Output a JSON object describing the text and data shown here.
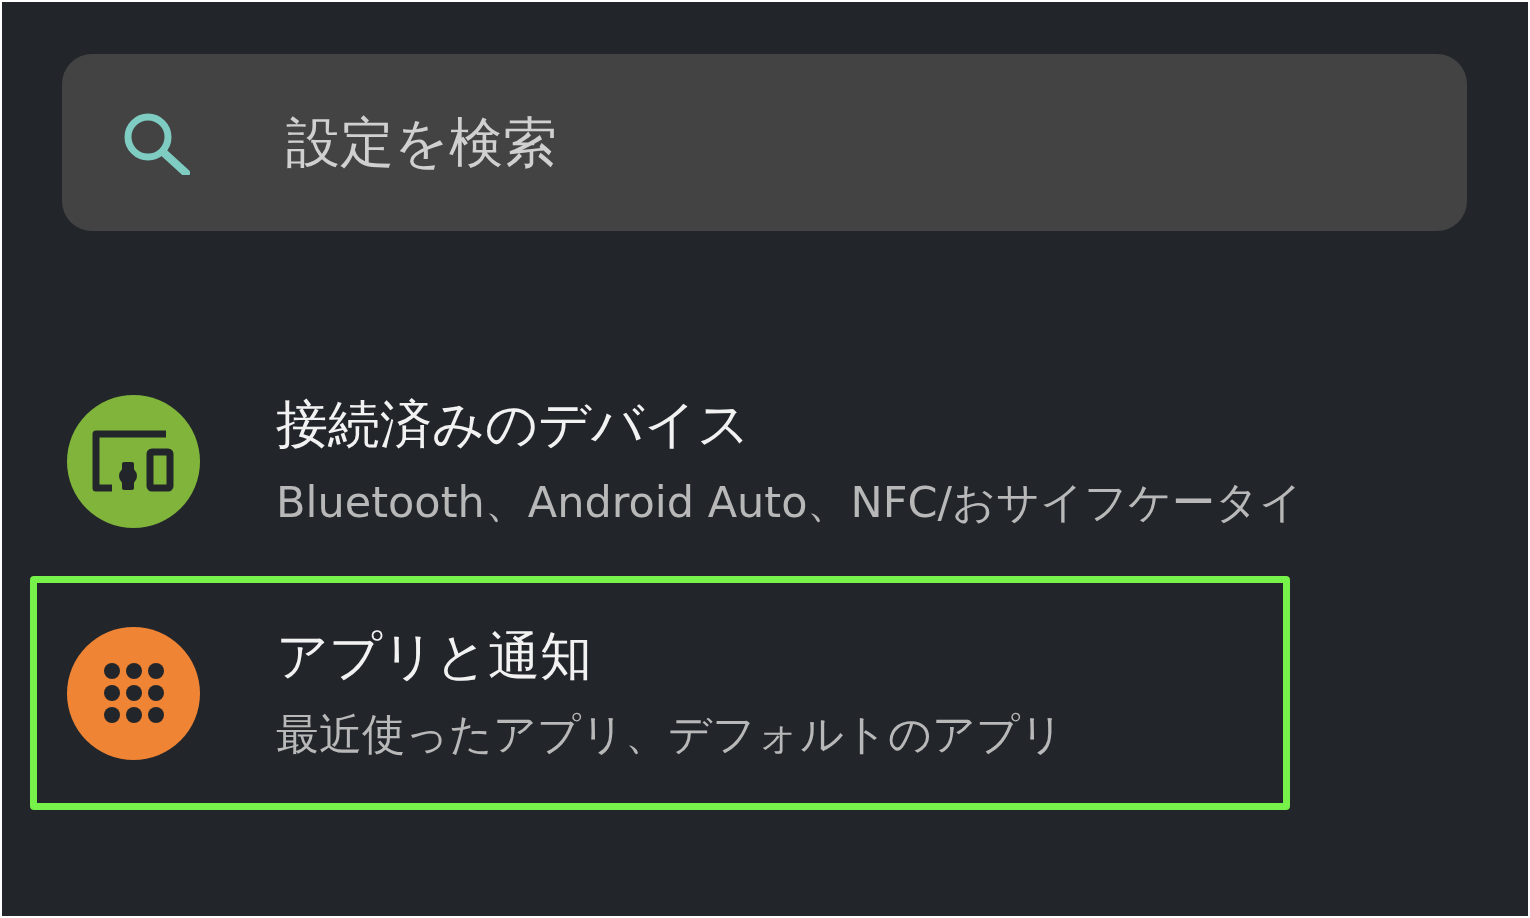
{
  "search": {
    "placeholder": "設定を検索"
  },
  "items": [
    {
      "title": "接続済みのデバイス",
      "subtitle": "Bluetooth、Android Auto、NFC/おサイフケータイ",
      "kind": "devices",
      "color": "#80b43a",
      "selected": false
    },
    {
      "title": "アプリと通知",
      "subtitle": "最近使ったアプリ、デフォルトのアプリ",
      "kind": "apps",
      "color": "#ee8434",
      "selected": true
    }
  ]
}
